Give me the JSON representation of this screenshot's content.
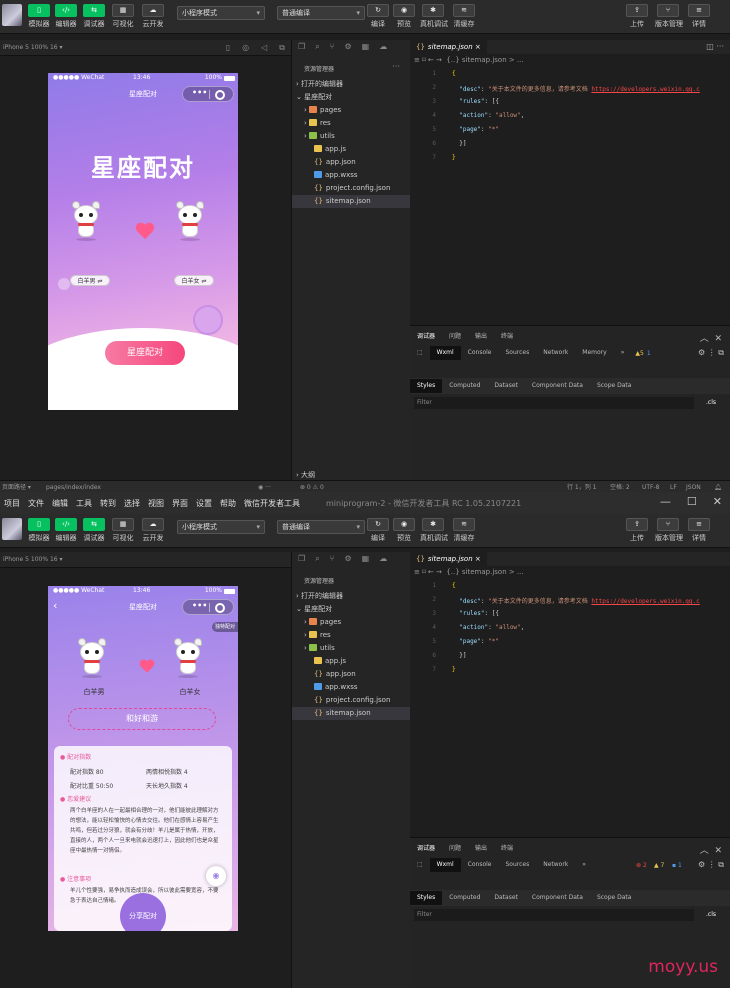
{
  "top": {
    "toolbar": {
      "buttons": [
        {
          "label": "模拟器",
          "icon": "phone-icon"
        },
        {
          "label": "编辑器",
          "icon": "code-icon"
        },
        {
          "label": "调试器",
          "icon": "debug-icon"
        },
        {
          "label": "可视化",
          "icon": "visual-icon"
        },
        {
          "label": "云开发",
          "icon": "cloud-icon"
        }
      ],
      "mode_select": "小程序模式",
      "compile_select": "普通编译",
      "right_buttons": [
        {
          "label": "编译"
        },
        {
          "label": "预览"
        },
        {
          "label": "真机调试"
        },
        {
          "label": "清缓存"
        }
      ],
      "far_right": [
        {
          "label": "上传"
        },
        {
          "label": "版本管理"
        },
        {
          "label": "详情"
        }
      ]
    },
    "device": "iPhone 5 100% 16 ▾",
    "phone": {
      "carrier": "●●●●● WeChat",
      "time": "13:46",
      "battery": "100%",
      "nav_title": "星座配对",
      "headline": "星座配对",
      "left_name": "白羊男 ⇌",
      "right_name": "白羊女 ⇌",
      "cta": "星座配对"
    },
    "explorer": {
      "title": "资源管理器",
      "section_open": "打开的编辑器",
      "project": "星座配对",
      "items": [
        "pages",
        "res",
        "utils",
        "app.js",
        "app.json",
        "app.wxss",
        "project.config.json",
        "sitemap.json"
      ],
      "outline": "大纲"
    },
    "editor": {
      "tab": "sitemap.json",
      "breadcrumb": "{..} sitemap.json > ...",
      "lines": [
        "1",
        "2",
        "3",
        "4",
        "5",
        "6",
        "7"
      ]
    },
    "devtools": {
      "top_tabs": [
        "调试器",
        "问题",
        "输出",
        "终端"
      ],
      "tabs": [
        "Wxml",
        "Console",
        "Sources",
        "Network",
        "Memory",
        "»"
      ],
      "warnings": "▲5",
      "info": "1",
      "sub_tabs": [
        "Styles",
        "Computed",
        "Dataset",
        "Component Data",
        "Scope Data"
      ],
      "filter": "Filter",
      "cls": ".cls"
    },
    "status": {
      "path_label": "页面路径 ▾",
      "path": "pages/index/index",
      "errors": "⊗ 0 ⚠ 0",
      "pos": "行 1，列 1",
      "spaces": "空格: 2",
      "enc": "UTF-8",
      "eol": "LF",
      "lang": "JSON"
    }
  },
  "bottom": {
    "menu": [
      "项目",
      "文件",
      "编辑",
      "工具",
      "转到",
      "选择",
      "视图",
      "界面",
      "设置",
      "帮助",
      "微信开发者工具"
    ],
    "window_title": "miniprogram-2 - 微信开发者工具 RC 1.05.2107221",
    "phone": {
      "nav_title": "星座配对",
      "badge": "独特配对",
      "left_name": "白羊男",
      "right_name": "白羊女",
      "retry": "和好和游",
      "sec1": "配对指数",
      "stats": [
        "配对指数 80",
        "两情相悦指数 4",
        "配对比重 50:50",
        "天长地久指数 4"
      ],
      "sec2": "恋爱建议",
      "advice": "两个白羊座的人在一起最相合理的一对，他们能彼此理解对方的想法，能以轻松愉快的心情去交往。他们在感情上容易产生共鸣，但若过分牙狼，就会有分歧！羊儿是属于热情，开放，直接的人，两个人一旦来电就会迅速打上，因此他们也是众星座中最热情一对情侣。",
      "sec3": "注意事项",
      "note": "羊儿个性要强，易争执而造成误会，所以彼此需要宽容，不要急于表达自己情绪。",
      "share": "分享配对"
    },
    "devtools": {
      "tabs": [
        "Wxml",
        "Console",
        "Sources",
        "Network",
        "»"
      ],
      "errors": "2",
      "warnings": "7",
      "info": "1"
    }
  },
  "watermark": "moyy.us"
}
